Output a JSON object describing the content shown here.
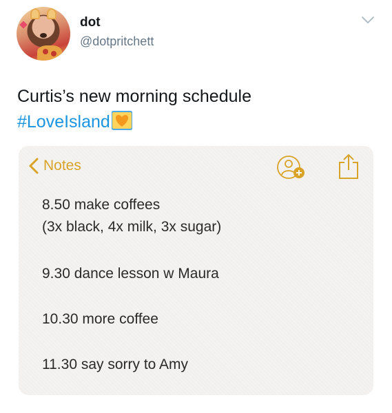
{
  "user": {
    "display_name": "dot",
    "handle": "@dotpritchett"
  },
  "tweet": {
    "text": "Curtis’s new morning schedule",
    "hashtag": "#LoveIsland"
  },
  "note": {
    "back_label": "Notes",
    "lines": [
      "8.50 make coffees",
      "(3x black, 4x milk, 3x sugar)",
      "9.30 dance lesson w Maura",
      "10.30 more coffee",
      "11.30 say sorry to Amy"
    ]
  },
  "colors": {
    "notes_accent": "#d8a327",
    "hashtag": "#1b95e0",
    "handle": "#657786",
    "card_bg": "#f4f3f1"
  },
  "icons": [
    "chevron-down-icon",
    "orange-heart-emoji",
    "chevron-left-icon",
    "add-person-icon",
    "share-icon"
  ]
}
